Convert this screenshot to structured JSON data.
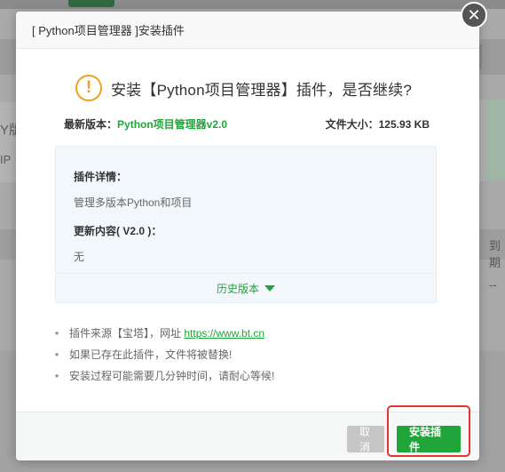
{
  "background": {
    "left_text_a": "Y版",
    "left_text_b": "IP",
    "right_header": "到期",
    "right_cell": "--"
  },
  "dialog": {
    "title": "[ Python项目管理器 ]安装插件",
    "close_label": "✕",
    "confirm_icon": "!",
    "confirm_text": "安装【Python项目管理器】插件，是否继续?",
    "latest_version_label": "最新版本：",
    "latest_version_value": "Python项目管理器v2.0",
    "file_size_label": "文件大小：",
    "file_size_value": "125.93 KB",
    "details": {
      "label": "插件详情：",
      "text": "管理多版本Python和项目",
      "update_label": "更新内容( V2.0 )：",
      "update_text": "无",
      "history_label": "历史版本"
    },
    "notes": {
      "source_prefix": "插件来源【宝塔】，网址",
      "source_url": "https://www.bt.cn",
      "replace_note": "如果已存在此插件，文件将被替换!",
      "wait_note": "安装过程可能需要几分钟时间，请耐心等候!"
    },
    "buttons": {
      "cancel": "取消",
      "install": "安装插件"
    }
  },
  "colors": {
    "accent_green": "#20a53a",
    "warning_orange": "#f0a020",
    "highlight_red": "#e0362e"
  }
}
